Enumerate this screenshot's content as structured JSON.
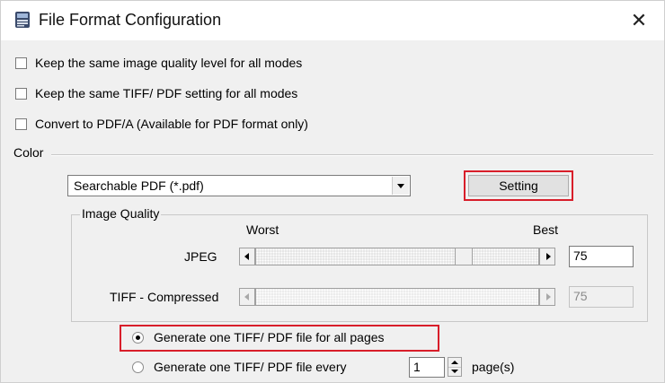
{
  "window": {
    "title": "File Format Configuration",
    "close_symbol": "✕"
  },
  "options": {
    "keep_quality": "Keep the same image quality level for all modes",
    "keep_tiff_pdf": "Keep the same TIFF/ PDF setting for all modes",
    "convert_pdfa": "Convert to PDF/A (Available for PDF format only)"
  },
  "color_section": {
    "label": "Color",
    "format_select_value": "Searchable PDF (*.pdf)",
    "setting_button": "Setting"
  },
  "image_quality": {
    "group_label": "Image Quality",
    "worst_label": "Worst",
    "best_label": "Best",
    "jpeg_label": "JPEG",
    "jpeg_value": "75",
    "jpeg_level": 0.75,
    "tiff_label": "TIFF - Compressed",
    "tiff_value": "75",
    "tiff_enabled": false
  },
  "generate": {
    "all_pages_label": "Generate one TIFF/ PDF file for all pages",
    "every_label": "Generate one TIFF/ PDF file every",
    "every_value": "1",
    "pages_suffix": "page(s)",
    "selected": "all_pages"
  },
  "colors": {
    "highlight": "#d81e2a",
    "dialog_bg": "#f0f0f0"
  }
}
